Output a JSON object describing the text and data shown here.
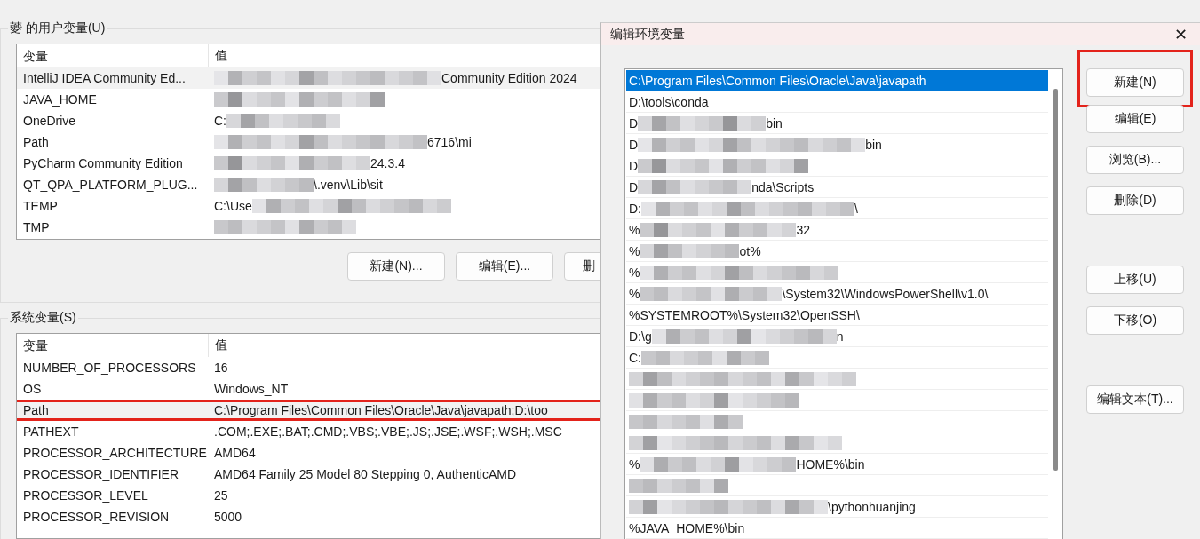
{
  "user_vars": {
    "title": "䕫 的用户变量(U)",
    "columns": [
      "变量",
      "值"
    ],
    "rows": [
      {
        "name": "IntelliJ IDEA Community Ed...",
        "redacted": true,
        "suffix": "Community Edition 2024",
        "selected": true
      },
      {
        "name": "JAVA_HOME",
        "redacted": true,
        "selected": false
      },
      {
        "name": "OneDrive",
        "prefix": "C:",
        "redacted": true,
        "selected": false
      },
      {
        "name": "Path",
        "redacted": true,
        "suffix": "6716\\mi",
        "selected": false
      },
      {
        "name": "PyCharm Community Edition",
        "redacted": true,
        "suffix": "24.3.4",
        "selected": false
      },
      {
        "name": "QT_QPA_PLATFORM_PLUG...",
        "redacted": true,
        "suffix": "\\.venv\\Lib\\sit",
        "selected": false
      },
      {
        "name": "TEMP",
        "prefix": "C:\\Use",
        "redacted": true,
        "selected": false
      },
      {
        "name": "TMP",
        "redacted": true,
        "selected": false
      }
    ],
    "buttons": [
      "新建(N)...",
      "编辑(E)...",
      "删"
    ]
  },
  "system_vars": {
    "title": "系统变量(S)",
    "columns": [
      "变量",
      "值"
    ],
    "rows": [
      {
        "name": "NUMBER_OF_PROCESSORS",
        "prefix": "16",
        "highlighted": false
      },
      {
        "name": "OS",
        "prefix": "Windows_NT",
        "highlighted": false
      },
      {
        "name": "Path",
        "prefix": "C:\\Program Files\\Common Files\\Oracle\\Java\\javapath;D:\\too",
        "highlighted": true
      },
      {
        "name": "PATHEXT",
        "prefix": ".COM;.EXE;.BAT;.CMD;.VBS;.VBE;.JS;.JSE;.WSF;.WSH;.MSC",
        "highlighted": false
      },
      {
        "name": "PROCESSOR_ARCHITECTURE",
        "prefix": "AMD64",
        "highlighted": false
      },
      {
        "name": "PROCESSOR_IDENTIFIER",
        "prefix": "AMD64 Family 25 Model 80 Stepping 0, AuthenticAMD",
        "highlighted": false
      },
      {
        "name": "PROCESSOR_LEVEL",
        "prefix": "25",
        "highlighted": false
      },
      {
        "name": "PROCESSOR_REVISION",
        "prefix": "5000",
        "highlighted": false
      }
    ]
  },
  "dialog": {
    "title": "编辑环境变量",
    "close": "✕",
    "items": [
      {
        "prefix": "C:\\Program Files\\Common Files\\Oracle\\Java\\javapath",
        "redacted": false,
        "selected": true
      },
      {
        "prefix": "D:\\tools\\conda",
        "redacted": false,
        "selected": false
      },
      {
        "prefix": "D",
        "redacted": true,
        "suffix": "bin",
        "selected": false
      },
      {
        "prefix": "D",
        "redacted": true,
        "suffix": "bin",
        "selected": false
      },
      {
        "prefix": "D",
        "redacted": true,
        "selected": false
      },
      {
        "prefix": "D",
        "redacted": true,
        "suffix": "nda\\Scripts",
        "selected": false
      },
      {
        "prefix": "D:",
        "redacted": true,
        "suffix": "\\",
        "selected": false
      },
      {
        "prefix": "%",
        "redacted": true,
        "suffix": "32",
        "selected": false
      },
      {
        "prefix": "%",
        "redacted": true,
        "suffix": "ot%",
        "selected": false
      },
      {
        "prefix": "%",
        "redacted": true,
        "selected": false
      },
      {
        "prefix": "%",
        "redacted": true,
        "suffix": "\\System32\\WindowsPowerShell\\v1.0\\",
        "selected": false
      },
      {
        "prefix": "%SYSTEMROOT%\\System32\\OpenSSH\\",
        "redacted": false,
        "selected": false
      },
      {
        "prefix": "D:\\g",
        "redacted": true,
        "suffix": "n",
        "selected": false
      },
      {
        "prefix": "C:",
        "redacted": true,
        "selected": false
      },
      {
        "redacted": true,
        "selected": false
      },
      {
        "redacted": true,
        "selected": false
      },
      {
        "redacted": true,
        "selected": false
      },
      {
        "redacted": true,
        "selected": false
      },
      {
        "prefix": "%",
        "redacted": true,
        "suffix": "HOME%\\bin",
        "selected": false
      },
      {
        "redacted": true,
        "selected": false
      },
      {
        "redacted": true,
        "suffix": "\\pythonhuanjing",
        "selected": false
      },
      {
        "prefix": "%JAVA_HOME%\\bin",
        "redacted": false,
        "selected": false
      }
    ],
    "button_groups": [
      [
        {
          "label": "新建(N)",
          "highlighted": true
        },
        {
          "label": "编辑(E)",
          "highlighted": false
        },
        {
          "label": "浏览(B)...",
          "highlighted": false
        },
        {
          "label": "删除(D)",
          "highlighted": false
        }
      ],
      [
        {
          "label": "上移(U)",
          "highlighted": false
        },
        {
          "label": "下移(O)",
          "highlighted": false
        }
      ],
      [
        {
          "label": "编辑文本(T)...",
          "highlighted": false
        }
      ]
    ]
  }
}
